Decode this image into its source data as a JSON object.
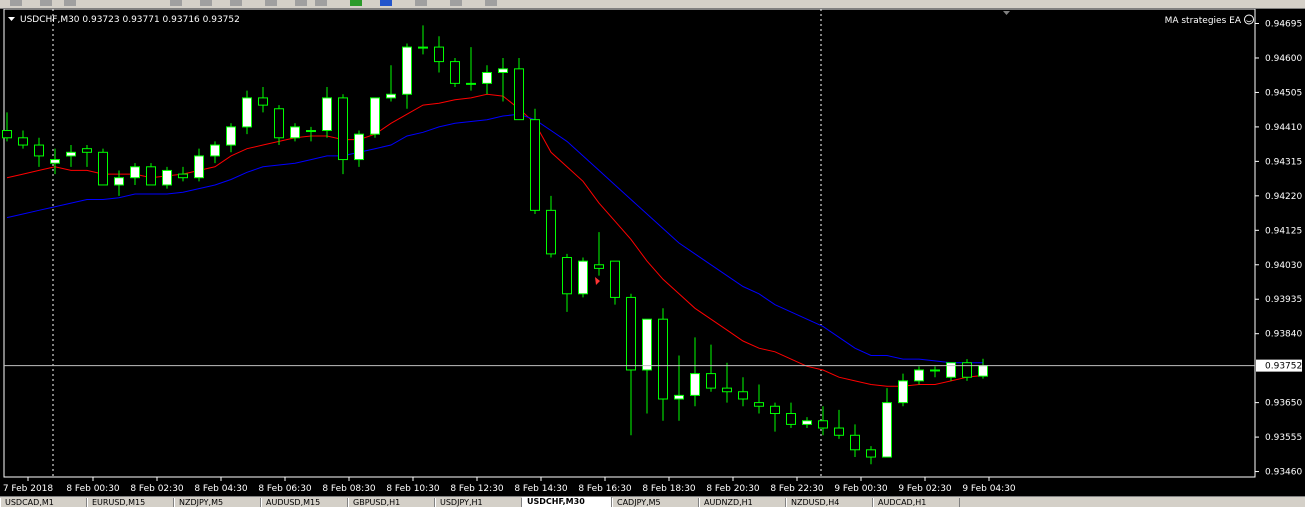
{
  "toolbar": {
    "icons": [
      "open-icon",
      "new-icon",
      "chart-icon",
      "cursor-icon",
      "line-icon",
      "pencil-icon",
      "text-icon",
      "zoom-in-icon",
      "zoom-out-icon",
      "add-indicator-icon",
      "refresh-icon",
      "template-icon",
      "period-icon",
      "dropdown-icon"
    ]
  },
  "chart": {
    "symbol_info": "USDCHF,M30  0.93723 0.93771 0.93716 0.93752",
    "ea_label": "MA strategies EA",
    "ea_icon": "smiley-icon",
    "current_price_label": "0.93752",
    "colors": {
      "background": "#000000",
      "bull_candle": "#ffffff",
      "bear_candle": "#000000",
      "wick": "#00ff00",
      "ma_fast": "#ff0000",
      "ma_slow": "#0000ff",
      "price_line": "#c0c0c0",
      "axis_text": "#ffffff"
    }
  },
  "chart_data": {
    "type": "candlestick",
    "symbol": "USDCHF",
    "timeframe": "M30",
    "ohlc_header": {
      "open": 0.93723,
      "high": 0.93771,
      "low": 0.93716,
      "close": 0.93752
    },
    "y_ticks": [
      0.94695,
      0.946,
      0.94505,
      0.9441,
      0.94315,
      0.9422,
      0.94125,
      0.9403,
      0.93935,
      0.9384,
      0.93752,
      0.9365,
      0.93555,
      0.9346
    ],
    "ylim": [
      0.93445,
      0.94735
    ],
    "x_labels": [
      "7 Feb 2018",
      "8 Feb 00:30",
      "8 Feb 02:30",
      "8 Feb 04:30",
      "8 Feb 06:30",
      "8 Feb 08:30",
      "8 Feb 10:30",
      "8 Feb 12:30",
      "8 Feb 14:30",
      "8 Feb 16:30",
      "8 Feb 18:30",
      "8 Feb 20:30",
      "8 Feb 22:30",
      "9 Feb 00:30",
      "9 Feb 02:30",
      "9 Feb 04:30"
    ],
    "candles": [
      [
        0.944,
        0.9445,
        0.9437,
        0.9438
      ],
      [
        0.9438,
        0.944,
        0.9435,
        0.9436
      ],
      [
        0.9436,
        0.9438,
        0.943,
        0.9433
      ],
      [
        0.9431,
        0.9435,
        0.9428,
        0.9432
      ],
      [
        0.9433,
        0.9436,
        0.943,
        0.9434
      ],
      [
        0.9435,
        0.9436,
        0.943,
        0.9434
      ],
      [
        0.9434,
        0.9435,
        0.9425,
        0.9425
      ],
      [
        0.9425,
        0.9429,
        0.9422,
        0.9427
      ],
      [
        0.9427,
        0.9431,
        0.9425,
        0.943
      ],
      [
        0.943,
        0.9431,
        0.9425,
        0.9425
      ],
      [
        0.9425,
        0.943,
        0.9424,
        0.9429
      ],
      [
        0.9428,
        0.943,
        0.9426,
        0.9427
      ],
      [
        0.9427,
        0.9435,
        0.9426,
        0.9433
      ],
      [
        0.9433,
        0.9437,
        0.9431,
        0.9436
      ],
      [
        0.9436,
        0.9442,
        0.9434,
        0.9441
      ],
      [
        0.9441,
        0.9451,
        0.9439,
        0.9449
      ],
      [
        0.9449,
        0.9452,
        0.9445,
        0.9447
      ],
      [
        0.9446,
        0.9447,
        0.9436,
        0.9438
      ],
      [
        0.9438,
        0.9442,
        0.9437,
        0.9441
      ],
      [
        0.944,
        0.9441,
        0.9437,
        0.944
      ],
      [
        0.944,
        0.9452,
        0.9438,
        0.9449
      ],
      [
        0.9449,
        0.945,
        0.9428,
        0.9432
      ],
      [
        0.9432,
        0.944,
        0.943,
        0.9439
      ],
      [
        0.9439,
        0.9449,
        0.9438,
        0.9449
      ],
      [
        0.9449,
        0.9458,
        0.9448,
        0.945
      ],
      [
        0.945,
        0.9464,
        0.9446,
        0.9463
      ],
      [
        0.9463,
        0.9469,
        0.9461,
        0.9463
      ],
      [
        0.9463,
        0.9466,
        0.9456,
        0.9459
      ],
      [
        0.9459,
        0.946,
        0.9452,
        0.9453
      ],
      [
        0.9453,
        0.9463,
        0.9451,
        0.9453
      ],
      [
        0.9453,
        0.9458,
        0.945,
        0.9456
      ],
      [
        0.9456,
        0.946,
        0.9448,
        0.9457
      ],
      [
        0.9457,
        0.946,
        0.9443,
        0.9443
      ],
      [
        0.9443,
        0.9446,
        0.9417,
        0.9418
      ],
      [
        0.9418,
        0.9422,
        0.9405,
        0.9406
      ],
      [
        0.9405,
        0.9406,
        0.939,
        0.9395
      ],
      [
        0.9395,
        0.9405,
        0.9394,
        0.9404
      ],
      [
        0.9403,
        0.9412,
        0.94,
        0.9402
      ],
      [
        0.9404,
        0.9404,
        0.9392,
        0.9394
      ],
      [
        0.9394,
        0.9395,
        0.9356,
        0.9374
      ],
      [
        0.9374,
        0.9388,
        0.9362,
        0.9388
      ],
      [
        0.9388,
        0.9391,
        0.936,
        0.9366
      ],
      [
        0.9366,
        0.9378,
        0.936,
        0.9367
      ],
      [
        0.9367,
        0.9383,
        0.9364,
        0.9373
      ],
      [
        0.9373,
        0.9381,
        0.9368,
        0.9369
      ],
      [
        0.9369,
        0.9376,
        0.9365,
        0.9368
      ],
      [
        0.9368,
        0.9372,
        0.9364,
        0.9366
      ],
      [
        0.9365,
        0.937,
        0.9362,
        0.9364
      ],
      [
        0.9364,
        0.9365,
        0.9357,
        0.9362
      ],
      [
        0.9362,
        0.9365,
        0.9358,
        0.9359
      ],
      [
        0.9359,
        0.9361,
        0.9358,
        0.936
      ],
      [
        0.936,
        0.9364,
        0.9356,
        0.9358
      ],
      [
        0.9358,
        0.9363,
        0.9355,
        0.9356
      ],
      [
        0.9356,
        0.9359,
        0.935,
        0.9352
      ],
      [
        0.9352,
        0.9353,
        0.9348,
        0.935
      ],
      [
        0.935,
        0.9369,
        0.935,
        0.9365
      ],
      [
        0.9365,
        0.9373,
        0.9364,
        0.9371
      ],
      [
        0.9371,
        0.9375,
        0.937,
        0.9374
      ],
      [
        0.9374,
        0.9375,
        0.9372,
        0.9374
      ],
      [
        0.9372,
        0.9376,
        0.9371,
        0.9376
      ],
      [
        0.9376,
        0.9377,
        0.9371,
        0.9372
      ],
      [
        0.93723,
        0.93771,
        0.93716,
        0.93752
      ]
    ],
    "series": [
      {
        "values": [
          0.9427,
          0.9428,
          0.9429,
          0.943,
          0.9429,
          0.9429,
          0.9428,
          0.9428,
          0.9428,
          0.9427,
          0.94275,
          0.9428,
          0.9429,
          0.943,
          0.9433,
          0.9435,
          0.9436,
          0.9437,
          0.9438,
          0.94385,
          0.94385,
          0.94375,
          0.94375,
          0.9439,
          0.9442,
          0.94445,
          0.9447,
          0.94475,
          0.94485,
          0.9449,
          0.945,
          0.94495,
          0.9446,
          0.9442,
          0.9434,
          0.943,
          0.9426,
          0.942,
          0.9415,
          0.941,
          0.9404,
          0.9399,
          0.9395,
          0.9391,
          0.9388,
          0.9385,
          0.9382,
          0.938,
          0.9379,
          0.9377,
          0.9375,
          0.9374,
          0.9372,
          0.9371,
          0.937,
          0.93695,
          0.93695,
          0.937,
          0.937,
          0.9371,
          0.9372,
          0.93725
        ]
      },
      {
        "values": [
          0.9416,
          0.9417,
          0.9418,
          0.9419,
          0.942,
          0.9421,
          0.9421,
          0.94215,
          0.94225,
          0.94225,
          0.94225,
          0.9423,
          0.9424,
          0.9425,
          0.94265,
          0.94285,
          0.943,
          0.94305,
          0.9431,
          0.9432,
          0.9433,
          0.9433,
          0.9434,
          0.9435,
          0.9436,
          0.94385,
          0.94395,
          0.9441,
          0.9442,
          0.94425,
          0.9443,
          0.9444,
          0.94445,
          0.9443,
          0.944,
          0.9437,
          0.9433,
          0.9429,
          0.9425,
          0.9421,
          0.9417,
          0.9413,
          0.9409,
          0.9406,
          0.9403,
          0.94,
          0.9397,
          0.9395,
          0.9392,
          0.939,
          0.9388,
          0.9386,
          0.9383,
          0.938,
          0.9378,
          0.9378,
          0.9377,
          0.9377,
          0.93765,
          0.9376,
          0.9376,
          0.9376
        ]
      }
    ],
    "current_price": 0.93752,
    "grid": false
  },
  "tabs": [
    {
      "label": "USDCAD,M1"
    },
    {
      "label": "EURUSD,M15"
    },
    {
      "label": "NZDJPY,M5"
    },
    {
      "label": "AUDUSD,M15"
    },
    {
      "label": "GBPUSD,H1"
    },
    {
      "label": "USDJPY,H1"
    },
    {
      "label": "USDCHF,M30",
      "active": true
    },
    {
      "label": "CADJPY,M5"
    },
    {
      "label": "AUDNZD,H1"
    },
    {
      "label": "NZDUSD,H4"
    },
    {
      "label": "AUDCAD,H1"
    }
  ]
}
